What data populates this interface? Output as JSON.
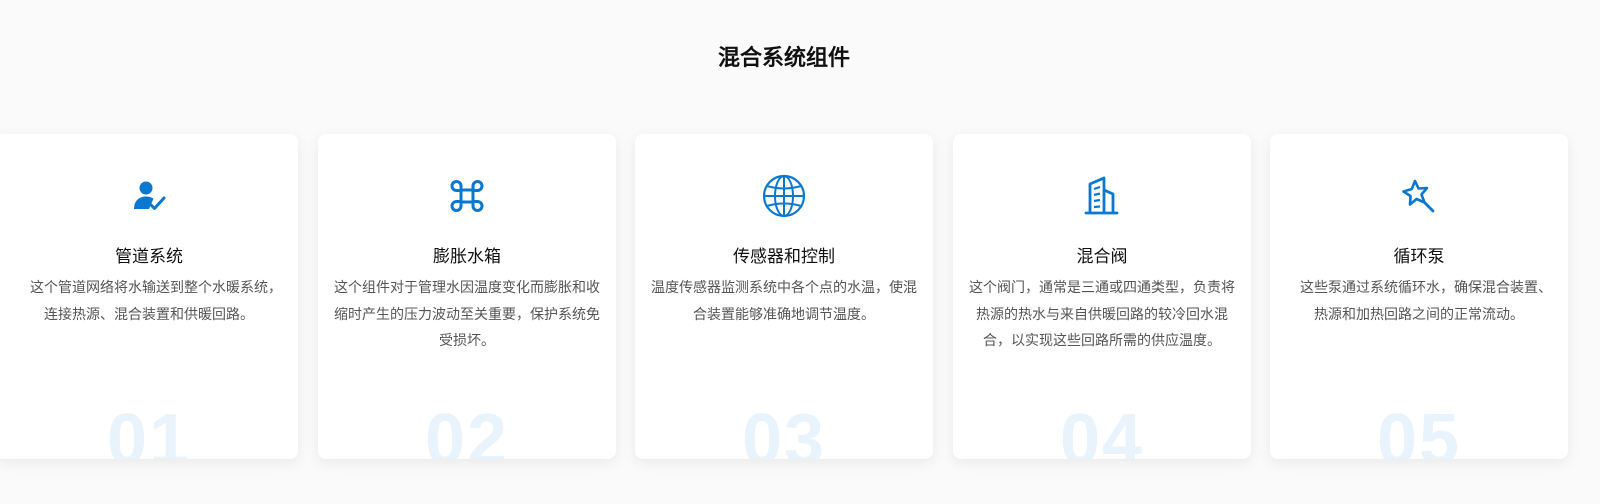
{
  "section": {
    "title": "混合系统组件"
  },
  "colors": {
    "accent": "#0a78d0",
    "number_watermark": "#e9f3fc",
    "card_bg": "#ffffff",
    "page_bg": "#fafafa"
  },
  "cards": [
    {
      "icon": "user-check-icon",
      "title": "管道系统",
      "text": "这个管道网络将水输送到整个水暖系统，连接热源、混合装置和供暖回路。",
      "number": "01"
    },
    {
      "icon": "command-icon",
      "title": "膨胀水箱",
      "text": "这个组件对于管理水因温度变化而膨胀和收缩时产生的压力波动至关重要，保护系统免受损坏。",
      "number": "02"
    },
    {
      "icon": "globe-icon",
      "title": "传感器和控制",
      "text": "温度传感器监测系统中各个点的水温，使混合装置能够准确地调节温度。",
      "number": "03"
    },
    {
      "icon": "building-icon",
      "title": "混合阀",
      "text": "这个阀门，通常是三通或四通类型，负责将热源的热水与来自供暖回路的较冷回水混合，以实现这些回路所需的供应温度。",
      "number": "04"
    },
    {
      "icon": "magic-star-icon",
      "title": "循环泵",
      "text": "这些泵通过系统循环水，确保混合装置、热源和加热回路之间的正常流动。",
      "number": "05"
    }
  ]
}
